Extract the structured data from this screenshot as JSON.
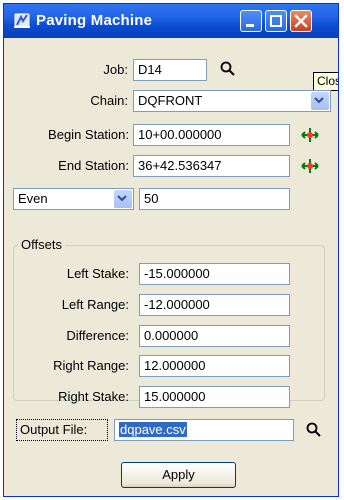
{
  "window": {
    "title": "Paving Machine",
    "tooltip": "Close",
    "icons": {
      "app": "app-icon",
      "minimize": "minimize-icon",
      "maximize": "maximize-icon",
      "close": "close-icon"
    }
  },
  "form": {
    "job": {
      "label": "Job:",
      "value": "D14",
      "icon": "search-icon"
    },
    "chain": {
      "label": "Chain:",
      "value": "DQFRONT",
      "icon": "chevron-down-icon"
    },
    "begin_station": {
      "label": "Begin Station:",
      "value": "10+00.000000",
      "icon": "station-locator-icon"
    },
    "end_station": {
      "label": "End Station:",
      "value": "36+42.536347",
      "icon": "station-locator-icon"
    },
    "interval": {
      "mode": "Even",
      "value": "50",
      "icon": "chevron-down-icon"
    },
    "offsets": {
      "title": "Offsets",
      "left_stake": {
        "label": "Left Stake:",
        "value": "-15.000000"
      },
      "left_range": {
        "label": "Left Range:",
        "value": "-12.000000"
      },
      "difference": {
        "label": "Difference:",
        "value": "0.000000"
      },
      "right_range": {
        "label": "Right Range:",
        "value": "12.000000"
      },
      "right_stake": {
        "label": "Right Stake:",
        "value": "15.000000"
      }
    },
    "output_file": {
      "label": "Output File:",
      "value": "dqpave.csv",
      "icon": "search-icon"
    },
    "apply_label": "Apply"
  },
  "colors": {
    "titlebar": "#0a4cd0",
    "window_bg": "#ece9d8",
    "field_border": "#7f9db9",
    "selection": "#316ac5",
    "close_button": "#c9411c"
  }
}
